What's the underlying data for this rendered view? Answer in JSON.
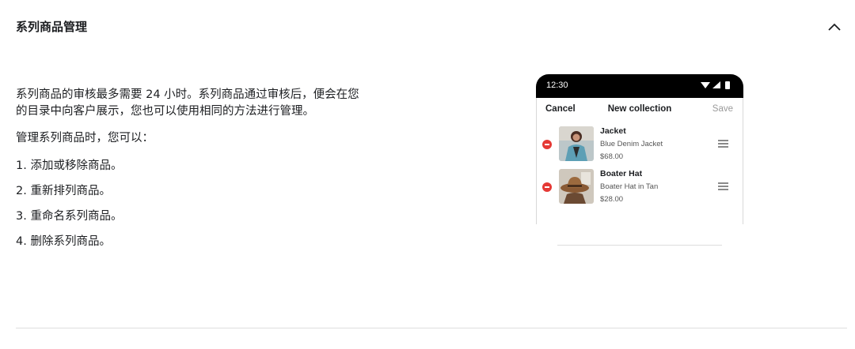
{
  "section": {
    "title": "系列商品管理",
    "collapse_icon": "chevron-up-icon"
  },
  "content": {
    "intro": "系列商品的审核最多需要 24 小时。系列商品通过审核后，便会在您的目录中向客户展示，您也可以使用相同的方法进行管理。",
    "lead": "管理系列商品时，您可以：",
    "steps": [
      "1. 添加或移除商品。",
      "2. 重新排列商品。",
      "3. 重命名系列商品。",
      "4. 删除系列商品。"
    ]
  },
  "phone": {
    "time": "12:30",
    "status_icons": [
      "wifi-icon",
      "signal-icon",
      "battery-icon"
    ],
    "nav": {
      "cancel": "Cancel",
      "title": "New collection",
      "save": "Save"
    },
    "products": [
      {
        "name": "Jacket",
        "subtitle": "Blue Denim Jacket",
        "price": "$68.00",
        "image": "jacket-photo"
      },
      {
        "name": "Boater Hat",
        "subtitle": "Boater Hat in Tan",
        "price": "$28.00",
        "image": "boater-hat-photo"
      }
    ]
  },
  "colors": {
    "text": "#1c1e21",
    "remove": "#e53935",
    "muted": "#9a9a9a",
    "divider": "#dedede"
  }
}
